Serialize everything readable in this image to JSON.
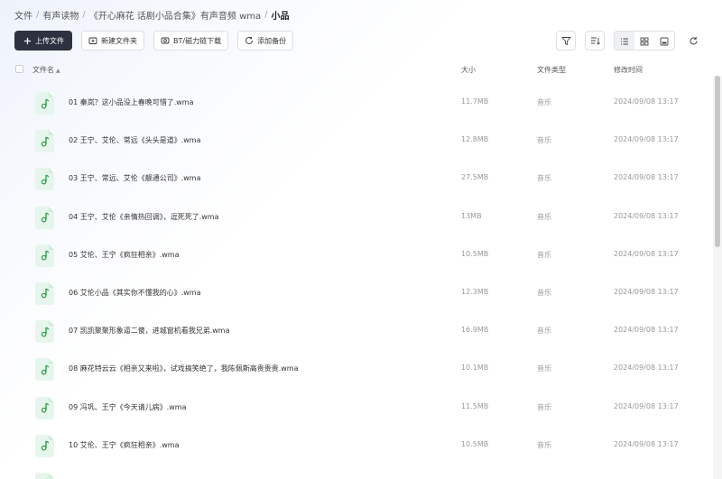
{
  "breadcrumb": [
    "文件",
    "有声读物",
    "《开心麻花 话剧小品合集》有声音频 wma",
    "小品"
  ],
  "toolbar": {
    "upload_label": "上传文件",
    "new_folder_label": "新建文件夹",
    "bt_download_label": "BT/磁力链下载",
    "add_backup_label": "添加备份"
  },
  "columns": {
    "name": "文件名",
    "size": "大小",
    "type": "文件类型",
    "modified": "修改时间"
  },
  "files": [
    {
      "name": "01 秦岚？这小品没上春晚可惜了.wma",
      "size": "11.7MB",
      "type": "音乐",
      "modified": "2024/09/08 13:17"
    },
    {
      "name": "02 王宁、艾伦、常远《头头是道》.wma",
      "size": "12.8MB",
      "type": "音乐",
      "modified": "2024/09/08 13:17"
    },
    {
      "name": "03 王宁、常远、艾伦《靓通公司》.wma",
      "size": "27.5MB",
      "type": "音乐",
      "modified": "2024/09/08 13:17"
    },
    {
      "name": "04 王宁、艾伦《亲情热回调》，逗死死了.wma",
      "size": "13MB",
      "type": "音乐",
      "modified": "2024/09/08 13:17"
    },
    {
      "name": "05 艾伦、王宁《疯狂相亲》.wma",
      "size": "10.5MB",
      "type": "音乐",
      "modified": "2024/09/08 13:17"
    },
    {
      "name": "06 艾伦小品《其实你不懂我的心》.wma",
      "size": "12.3MB",
      "type": "音乐",
      "modified": "2024/09/08 13:17"
    },
    {
      "name": "07 凯凯聚聚形象逼二傻，进城窗机看我兄弟.wma",
      "size": "16.9MB",
      "type": "音乐",
      "modified": "2024/09/08 13:17"
    },
    {
      "name": "08 麻花特云云《相亲又来啦》，试戏搞笑绝了，我陈佩斯高贵贵贵.wma",
      "size": "10.1MB",
      "type": "音乐",
      "modified": "2024/09/08 13:17"
    },
    {
      "name": "09 冯巩、王宁《今天请儿病》.wma",
      "size": "11.5MB",
      "type": "音乐",
      "modified": "2024/09/08 13:17"
    },
    {
      "name": "10 艾伦、王宁《疯狂相亲》.wma",
      "size": "10.5MB",
      "type": "音乐",
      "modified": "2024/09/08 13:17"
    },
    {
      "name": "",
      "size": "",
      "type": "",
      "modified": ""
    }
  ],
  "colors": {
    "accent_dark": "#2d3140",
    "music_icon": "#2ea14b",
    "music_icon_bg": "#e7f6ec"
  },
  "icons": {
    "upload": "plus-icon",
    "new_folder": "folder-plus-icon",
    "bt": "magnet-icon",
    "backup": "backup-icon",
    "filter": "filter-icon",
    "sort": "sort-icon",
    "list_view": "list-view-icon",
    "grid_view": "grid-view-icon",
    "large_view": "large-view-icon",
    "refresh": "refresh-icon",
    "file": "music-note-icon"
  }
}
